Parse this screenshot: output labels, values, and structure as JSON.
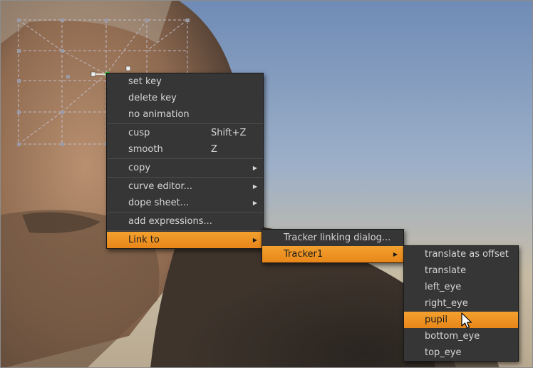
{
  "context_menu": {
    "items": [
      {
        "label": "set key"
      },
      {
        "label": "delete key"
      },
      {
        "label": "no animation"
      },
      {
        "label": "cusp",
        "shortcut": "Shift+Z"
      },
      {
        "label": "smooth",
        "shortcut": "Z"
      },
      {
        "label": "copy",
        "submenu": true
      },
      {
        "label": "curve editor...",
        "submenu": true
      },
      {
        "label": "dope sheet...",
        "submenu": true
      },
      {
        "label": "add expressions..."
      },
      {
        "label": "Link to",
        "submenu": true,
        "highlighted": true
      }
    ]
  },
  "link_to_menu": {
    "items": [
      {
        "label": "Tracker linking dialog..."
      },
      {
        "label": "Tracker1",
        "submenu": true,
        "highlighted": true
      }
    ]
  },
  "tracker1_menu": {
    "items": [
      {
        "label": "translate as offset"
      },
      {
        "label": "translate"
      },
      {
        "label": "left_eye"
      },
      {
        "label": "right_eye"
      },
      {
        "label": "pupil",
        "highlighted": true
      },
      {
        "label": "bottom_eye"
      },
      {
        "label": "top_eye"
      }
    ]
  },
  "colors": {
    "menu_bg": "#363636",
    "highlight": "#f0962a",
    "menu_text": "#d6d6d6",
    "selected_point": "#3cd23c"
  },
  "icons": {
    "submenu": "arrow-right-icon",
    "cursor": "mouse-pointer-icon"
  }
}
